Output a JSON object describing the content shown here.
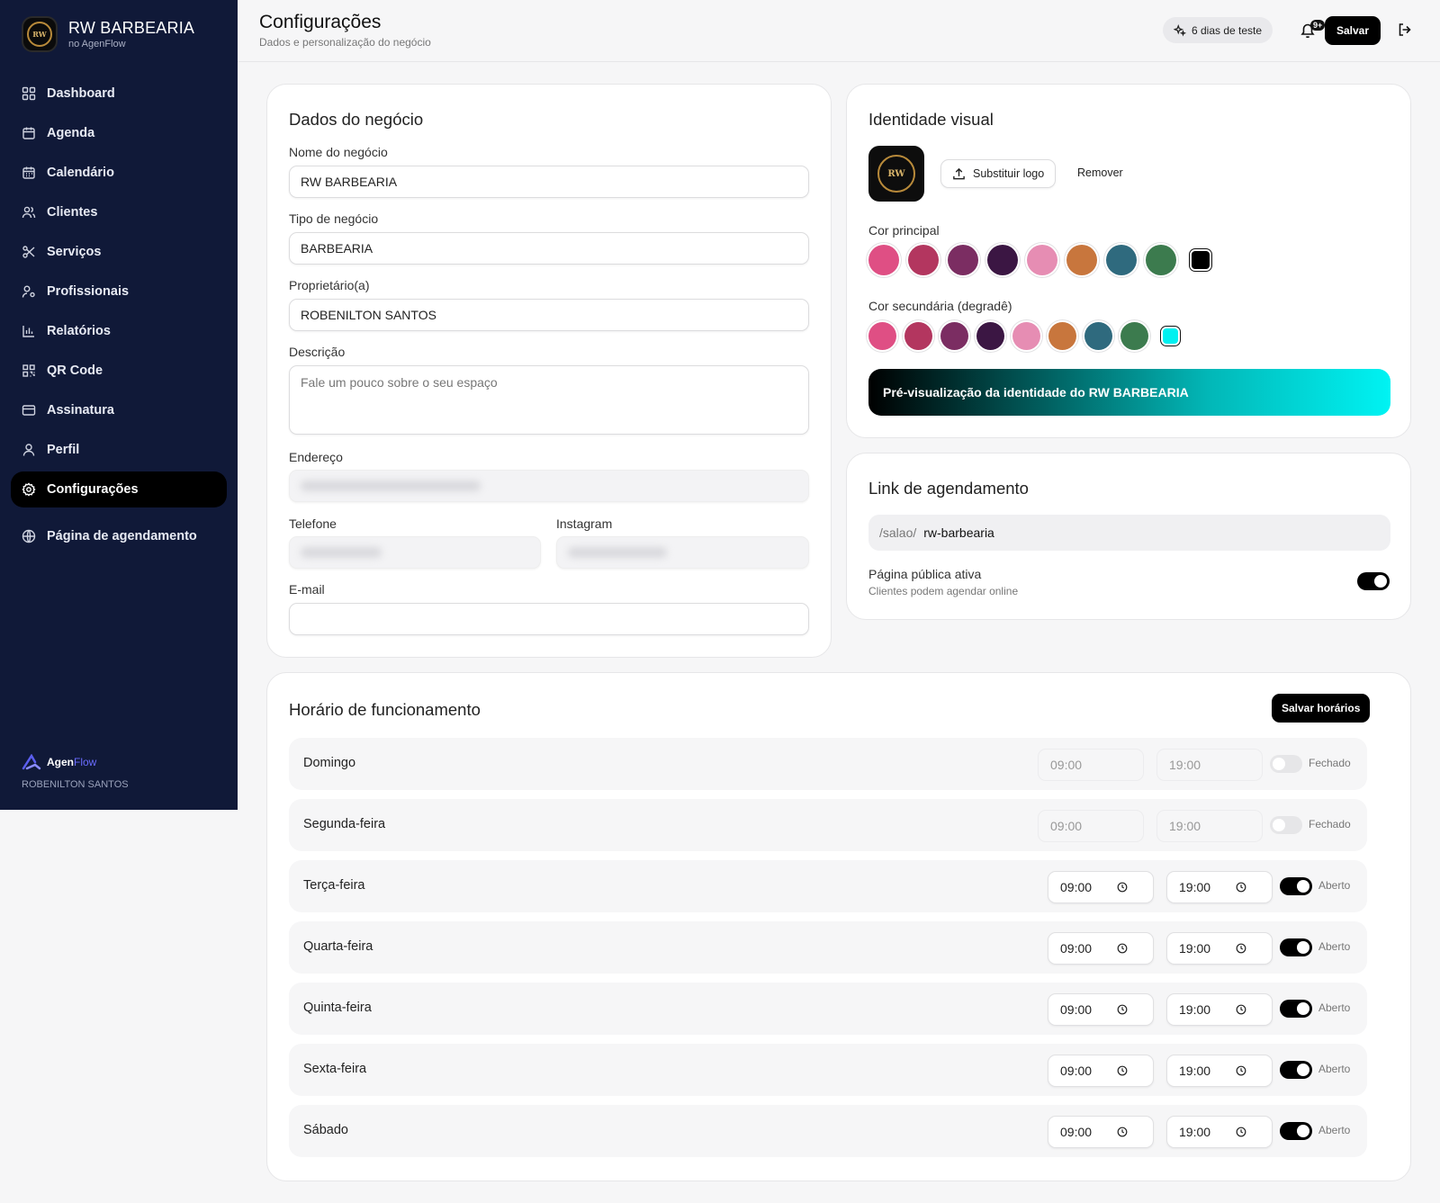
{
  "sidebar": {
    "brand_name": "RW BARBEARIA",
    "brand_sub": "no AgenFlow",
    "logo_text": "RW",
    "items": [
      {
        "label": "Dashboard",
        "icon": "grid-icon"
      },
      {
        "label": "Agenda",
        "icon": "calendar-icon"
      },
      {
        "label": "Calendário",
        "icon": "calendar-days-icon"
      },
      {
        "label": "Clientes",
        "icon": "users-icon"
      },
      {
        "label": "Serviços",
        "icon": "scissors-icon"
      },
      {
        "label": "Profissionais",
        "icon": "user-cog-icon"
      },
      {
        "label": "Relatórios",
        "icon": "bar-chart-icon"
      },
      {
        "label": "QR Code",
        "icon": "qr-code-icon"
      },
      {
        "label": "Assinatura",
        "icon": "credit-card-icon"
      },
      {
        "label": "Perfil",
        "icon": "user-icon"
      },
      {
        "label": "Configurações",
        "icon": "gear-icon",
        "active": true
      },
      {
        "label": "Página de agendamento",
        "icon": "globe-icon"
      }
    ],
    "footer": {
      "brand_a": "Agen",
      "brand_b": "Flow",
      "owner": "ROBENILTON SANTOS"
    }
  },
  "header": {
    "title": "Configurações",
    "subtitle": "Dados e personalização do negócio",
    "trial": "6 dias de teste",
    "notif_badge": "9+",
    "save": "Salvar"
  },
  "business": {
    "title": "Dados do negócio",
    "name_label": "Nome do negócio",
    "name_value": "RW BARBEARIA",
    "type_label": "Tipo de negócio",
    "type_value": "BARBEARIA",
    "owner_label": "Proprietário(a)",
    "owner_value": "ROBENILTON SANTOS",
    "desc_label": "Descrição",
    "desc_placeholder": "Fale um pouco sobre o seu espaço",
    "address_label": "Endereço",
    "phone_label": "Telefone",
    "instagram_label": "Instagram",
    "email_label": "E-mail",
    "email_value": ""
  },
  "identity": {
    "title": "Identidade visual",
    "replace_logo": "Substituir logo",
    "remove": "Remover",
    "primary_label": "Cor principal",
    "secondary_label": "Cor secundária (degradê)",
    "primary_colors": [
      "#df4f84",
      "#b3365f",
      "#7b2d62",
      "#3b1643",
      "#e68db3",
      "#c8763d",
      "#2f6a7e",
      "#3c7b4e",
      "#000000"
    ],
    "secondary_colors": [
      "#df4f84",
      "#b3365f",
      "#7b2d62",
      "#3b1643",
      "#e68db3",
      "#c8763d",
      "#2f6a7e",
      "#3c7b4e",
      "#00f0f0"
    ],
    "primary_selected": "#000000",
    "secondary_selected": "#00f0f0",
    "preview": "Pré-visualização da identidade do RW BARBEARIA"
  },
  "link": {
    "title": "Link de agendamento",
    "prefix": "/salao/",
    "slug": "rw-barbearia",
    "public_label": "Página pública ativa",
    "public_sub": "Clientes podem agendar online",
    "public_on": true
  },
  "hours": {
    "title": "Horário de funcionamento",
    "save": "Salvar horários",
    "days": [
      {
        "day": "Domingo",
        "open": "09:00",
        "close": "19:00",
        "state": "Fechado",
        "enabled": false
      },
      {
        "day": "Segunda-feira",
        "open": "09:00",
        "close": "19:00",
        "state": "Fechado",
        "enabled": false
      },
      {
        "day": "Terça-feira",
        "open": "09:00",
        "close": "19:00",
        "state": "Aberto",
        "enabled": true
      },
      {
        "day": "Quarta-feira",
        "open": "09:00",
        "close": "19:00",
        "state": "Aberto",
        "enabled": true
      },
      {
        "day": "Quinta-feira",
        "open": "09:00",
        "close": "19:00",
        "state": "Aberto",
        "enabled": true
      },
      {
        "day": "Sexta-feira",
        "open": "09:00",
        "close": "19:00",
        "state": "Aberto",
        "enabled": true
      },
      {
        "day": "Sábado",
        "open": "09:00",
        "close": "19:00",
        "state": "Aberto",
        "enabled": true
      }
    ]
  }
}
